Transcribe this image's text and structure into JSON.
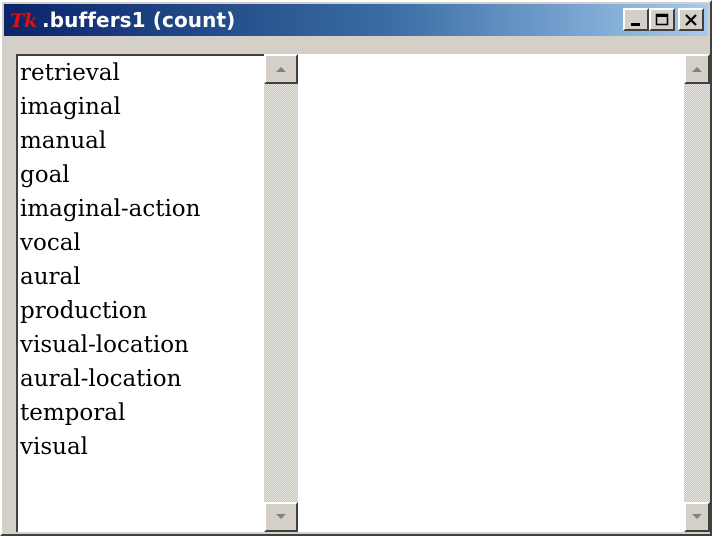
{
  "window": {
    "title": ".buffers1 (count)",
    "logo_icon": "tk-feather-icon"
  },
  "title_buttons": {
    "minimize_icon": "minimize-icon",
    "maximize_icon": "maximize-icon",
    "close_icon": "close-icon"
  },
  "buffer_list": {
    "items": [
      "retrieval",
      "imaginal",
      "manual",
      "goal",
      "imaginal-action",
      "vocal",
      "aural",
      "production",
      "visual-location",
      "aural-location",
      "temporal",
      "visual"
    ]
  },
  "colors": {
    "titlebar_start": "#0a246a",
    "titlebar_end": "#a6caf0",
    "face": "#d4d0c8"
  }
}
